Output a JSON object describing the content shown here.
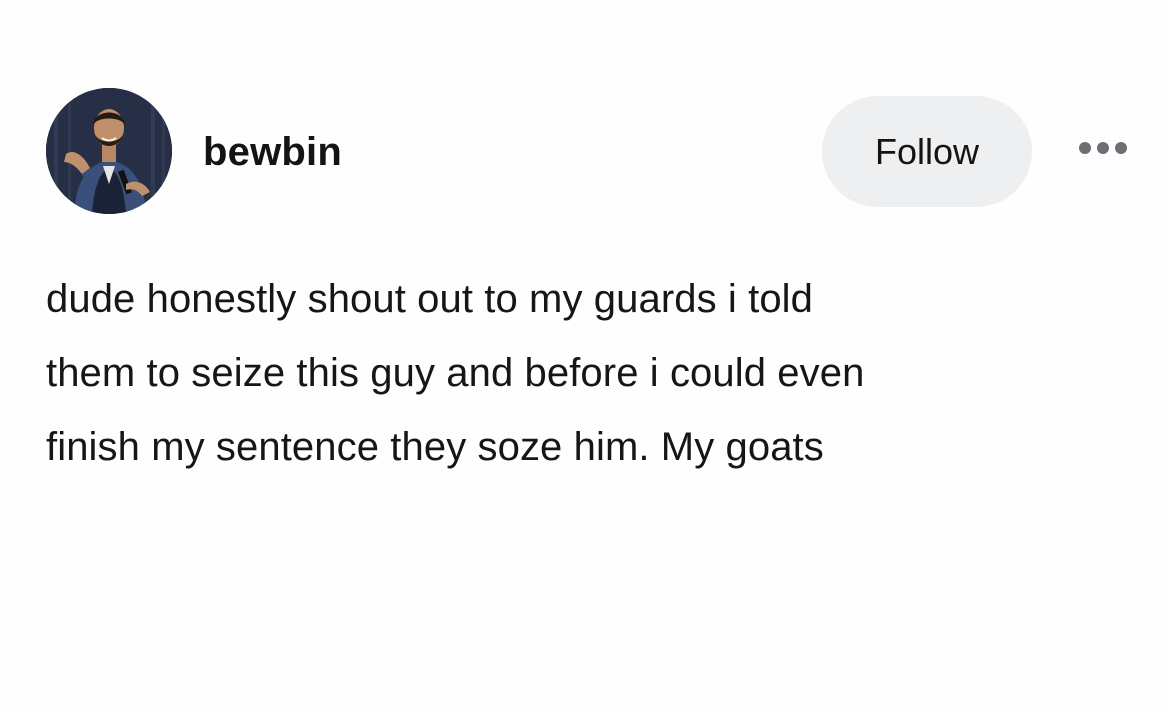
{
  "post": {
    "author": {
      "username": "bewbin",
      "avatar_icon": "profile-photo-person-with-microphone"
    },
    "follow_label": "Follow",
    "more_icon": "ellipsis-icon",
    "text_lines": [
      "dude honestly shout out to my guards i told",
      "them to seize this guy and before i could even",
      "finish my sentence they soze him. My goats"
    ]
  },
  "colors": {
    "background": "#fefefe",
    "text": "#161616",
    "follow_button_bg": "#eeeff0",
    "more_dots": "#6b6f74"
  }
}
